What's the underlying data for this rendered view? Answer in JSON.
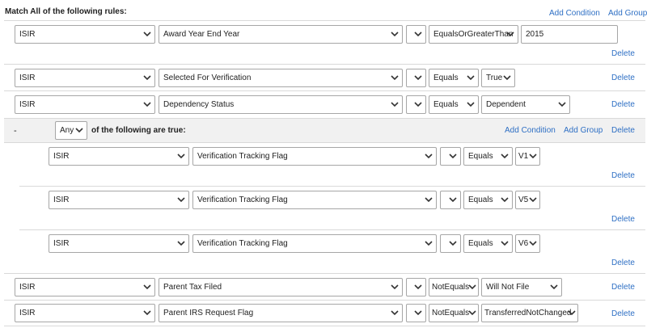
{
  "header": {
    "title": "Match All of the following rules:",
    "add_condition": "Add Condition",
    "add_group": "Add Group"
  },
  "rows": [
    {
      "source": "ISIR",
      "field": "Award Year End Year",
      "extra": "",
      "operator": "EqualsOrGreaterThan",
      "value": "2015",
      "delete": "Delete"
    },
    {
      "source": "ISIR",
      "field": "Selected For Verification",
      "extra": "",
      "operator": "Equals",
      "value": "True",
      "delete": "Delete"
    },
    {
      "source": "ISIR",
      "field": "Dependency Status",
      "extra": "",
      "operator": "Equals",
      "value": "Dependent",
      "delete": "Delete"
    }
  ],
  "group": {
    "collapse": "-",
    "match": "Any",
    "text": "of the following are true:",
    "add_condition": "Add Condition",
    "add_group": "Add Group",
    "delete": "Delete",
    "rows": [
      {
        "source": "ISIR",
        "field": "Verification Tracking Flag",
        "extra": "",
        "operator": "Equals",
        "value": "V1",
        "delete": "Delete"
      },
      {
        "source": "ISIR",
        "field": "Verification Tracking Flag",
        "extra": "",
        "operator": "Equals",
        "value": "V5",
        "delete": "Delete"
      },
      {
        "source": "ISIR",
        "field": "Verification Tracking Flag",
        "extra": "",
        "operator": "Equals",
        "value": "V6",
        "delete": "Delete"
      }
    ]
  },
  "rows_after": [
    {
      "source": "ISIR",
      "field": "Parent Tax Filed",
      "extra": "",
      "operator": "NotEquals",
      "value": "Will Not File",
      "delete": "Delete"
    },
    {
      "source": "ISIR",
      "field": "Parent IRS Request Flag",
      "extra": "",
      "operator": "NotEquals",
      "value": "TransferredNotChanged",
      "delete": "Delete"
    }
  ],
  "icons": {
    "dropdown": "chevron-down-icon"
  },
  "colors": {
    "link": "#2e6fc4",
    "border": "#a6a6a6",
    "group_band": "#f1f1f1"
  }
}
